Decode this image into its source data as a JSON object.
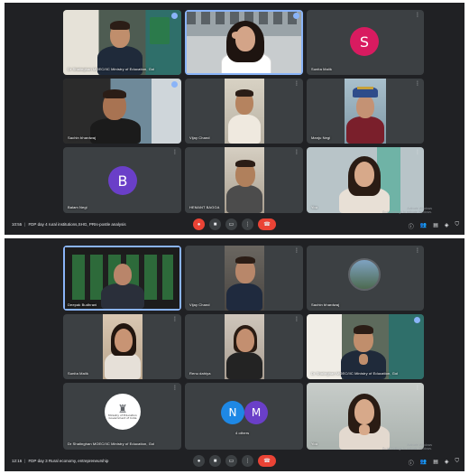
{
  "top_screenshot": {
    "tiles": [
      {
        "name": "Dr Shalinghan MOEC/IIC Ministry of Education, GoI",
        "initial": null,
        "avatar_color": null
      },
      {
        "name": "",
        "initial": null,
        "avatar_color": null
      },
      {
        "name": "Sunita Malik",
        "initial": "S",
        "avatar_color": "#d81b60"
      },
      {
        "name": "Sachin bhardwaj",
        "initial": null,
        "avatar_color": null
      },
      {
        "name": "Vijay Chand",
        "initial": null,
        "avatar_color": null
      },
      {
        "name": "Manju Negi",
        "initial": null,
        "avatar_color": null
      },
      {
        "name": "Balam Negi",
        "initial": "B",
        "avatar_color": "#6a3fc8"
      },
      {
        "name": "HEMANT BAGGA",
        "initial": null,
        "avatar_color": null
      },
      {
        "name": "You",
        "initial": null,
        "avatar_color": null
      }
    ],
    "time": "10:55",
    "meeting_title": "FDP day 4 rural institutions,SHG, PRIs-postle analysis",
    "watermark": "Activate Windows\nGo to Settings to activate Windows."
  },
  "bottom_screenshot": {
    "tiles": [
      {
        "name": "Deepak Budhrani",
        "initial": null
      },
      {
        "name": "Vijay Chand",
        "initial": null
      },
      {
        "name": "Sachin bhardwaj",
        "initial": null
      },
      {
        "name": "Sunita Malik",
        "initial": null
      },
      {
        "name": "Renu dahiya",
        "initial": null
      },
      {
        "name": "Dr Shalinghan MOEC/IIC Ministry of Education, GoI",
        "initial": null
      },
      {
        "name": "Dr Shalinghan MOEC/IIC Ministry of Education, GoI",
        "initial": null
      },
      {
        "name": "4 others",
        "initial": null
      },
      {
        "name": "You",
        "initial": null
      }
    ],
    "others_initials": [
      "N",
      "M"
    ],
    "others_colors": [
      "#1e88e5",
      "#6a3fc8"
    ],
    "logo_caption": "Ministry of Education\nGovernment of India",
    "time": "12:16",
    "meeting_title": "FDP day 3 Rural economy, entrepreneurship",
    "watermark": "Activate Windows\nGo to Settings to activate Windows."
  },
  "icons": {
    "mic": "mic-icon",
    "camera": "camera-icon",
    "present": "present-icon",
    "more": "more-options-icon",
    "end_call": "end-call-icon",
    "info": "info-icon",
    "people": "people-icon",
    "chat": "chat-icon",
    "activities": "activities-icon",
    "host_controls": "shield-icon"
  },
  "colors": {
    "background": "#202124",
    "tile": "#3c4043",
    "end_call": "#ea4335",
    "speaking_outline": "#8ab4f8"
  }
}
